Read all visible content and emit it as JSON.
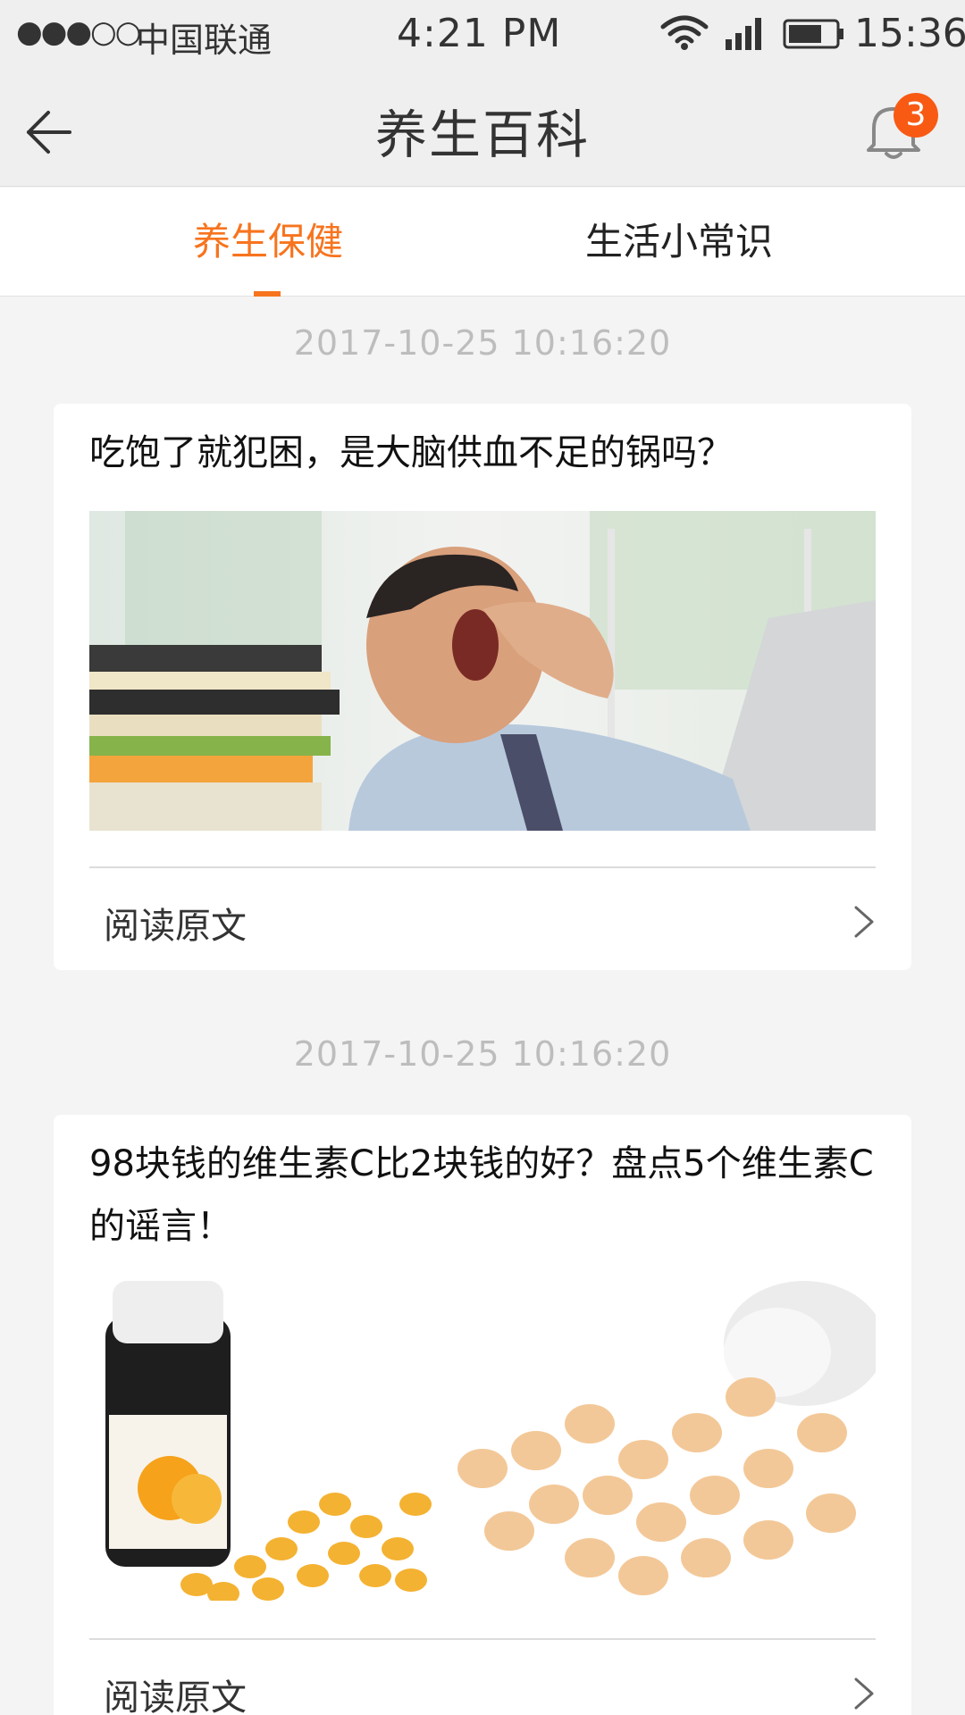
{
  "status_bar": {
    "signal_dots": "●●●○○",
    "carrier": "中国联通",
    "time": "4:21 PM",
    "clock": "15:36",
    "icons": [
      "wifi-icon",
      "cellular-signal-icon",
      "battery-icon"
    ]
  },
  "nav": {
    "title": "养生百科",
    "notification_count": "3",
    "icons": [
      "back-arrow-icon",
      "bell-icon"
    ]
  },
  "tabs": [
    {
      "label": "养生保健",
      "active": true
    },
    {
      "label": "生活小常识",
      "active": false
    }
  ],
  "articles": [
    {
      "date": "2017-10-25  10:16:20",
      "title": "吃饱了就犯困，是大脑供血不足的锅吗？",
      "image": "yawning-man-at-desk-image",
      "read_label": "阅读原文"
    },
    {
      "date": "2017-10-25  10:16:20",
      "title": "98块钱的维生素C比2块钱的好？盘点5个维生素C的谣言！",
      "image": "vitamin-c-tablets-image",
      "read_label": "阅读原文"
    }
  ],
  "colors": {
    "accent": "#f7741e",
    "badge": "#f85a14",
    "background": "#f4f4f4",
    "date_text": "#bdbdbd"
  }
}
